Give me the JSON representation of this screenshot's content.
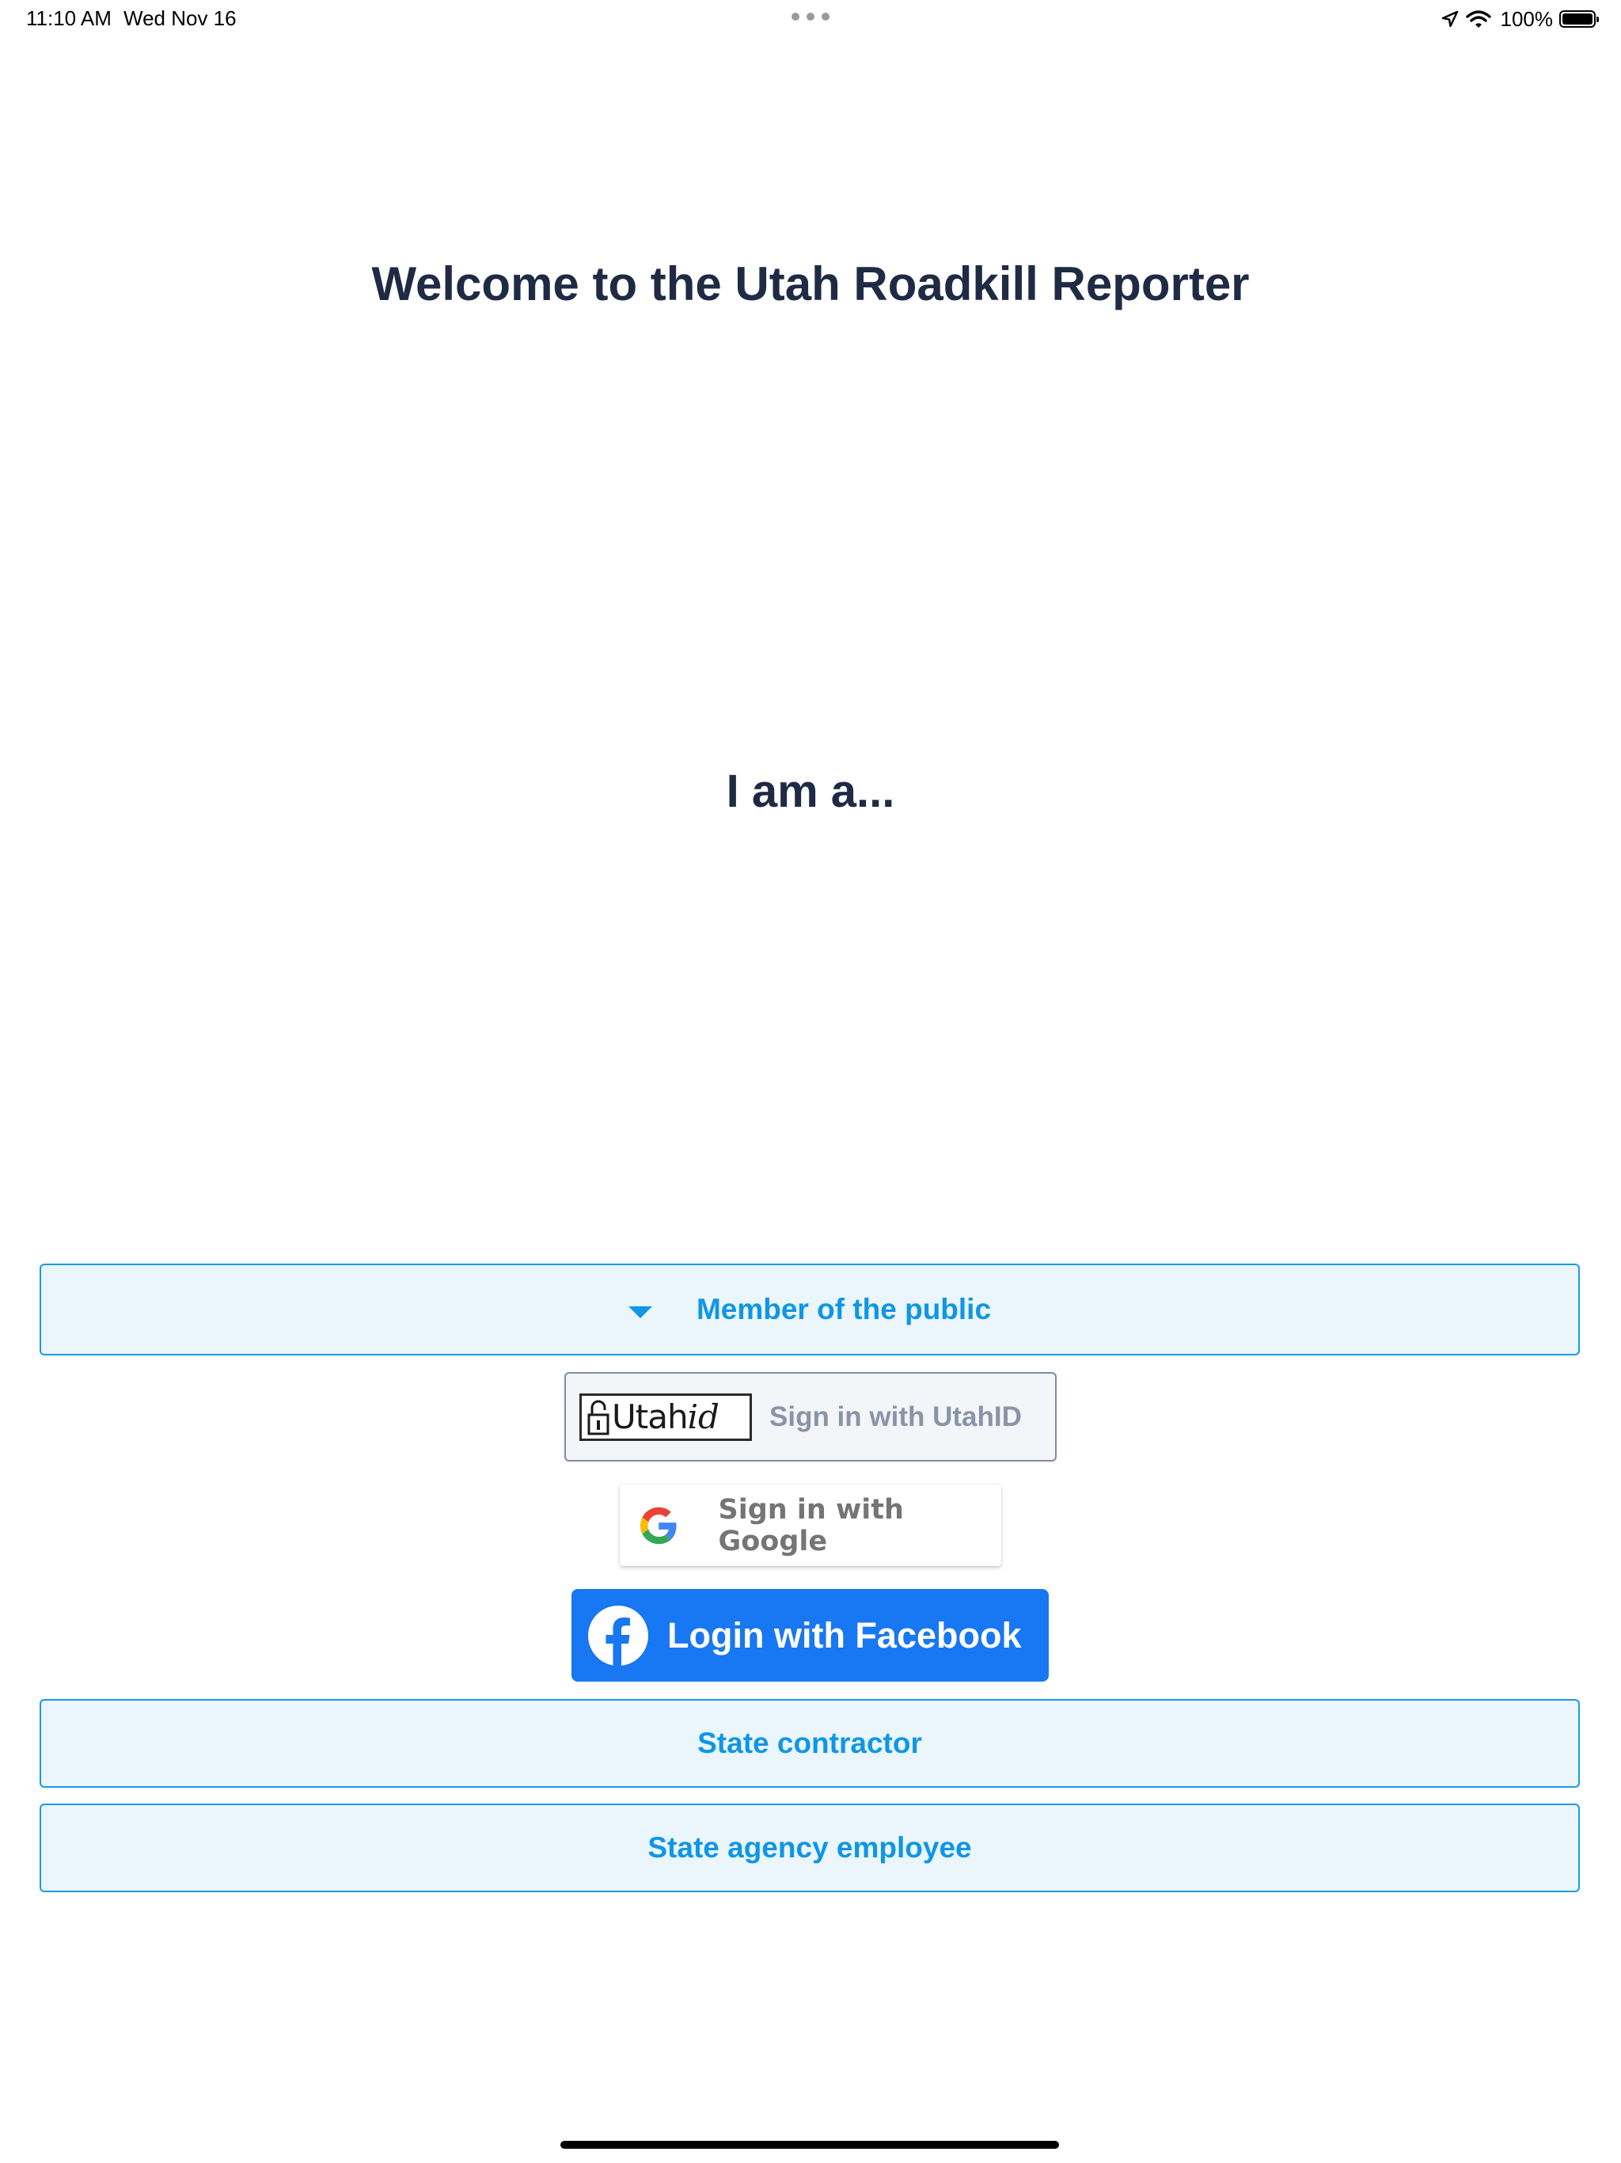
{
  "status_bar": {
    "time": "11:10 AM",
    "date": "Wed Nov 16",
    "battery": "100%"
  },
  "page": {
    "title": "Welcome to the Utah Roadkill Reporter",
    "subtitle": "I am a..."
  },
  "roles": {
    "public_label": "Member of the public",
    "contractor_label": "State contractor",
    "employee_label": "State agency employee"
  },
  "sign_in": {
    "utahid_logo_utah": "Utah",
    "utahid_logo_id": "id",
    "utahid_label": "Sign in with UtahID",
    "google_label": "Sign in with Google",
    "facebook_label": "Login with Facebook"
  },
  "colors": {
    "accent": "#0f96e6",
    "role_bg": "#eaf5fc",
    "title_text": "#1f2a44",
    "facebook_blue": "#1877f2"
  },
  "icons": [
    "location-arrow-icon",
    "wifi-icon",
    "battery-icon",
    "caret-down-icon",
    "lock-icon",
    "google-g-icon",
    "facebook-f-icon"
  ]
}
